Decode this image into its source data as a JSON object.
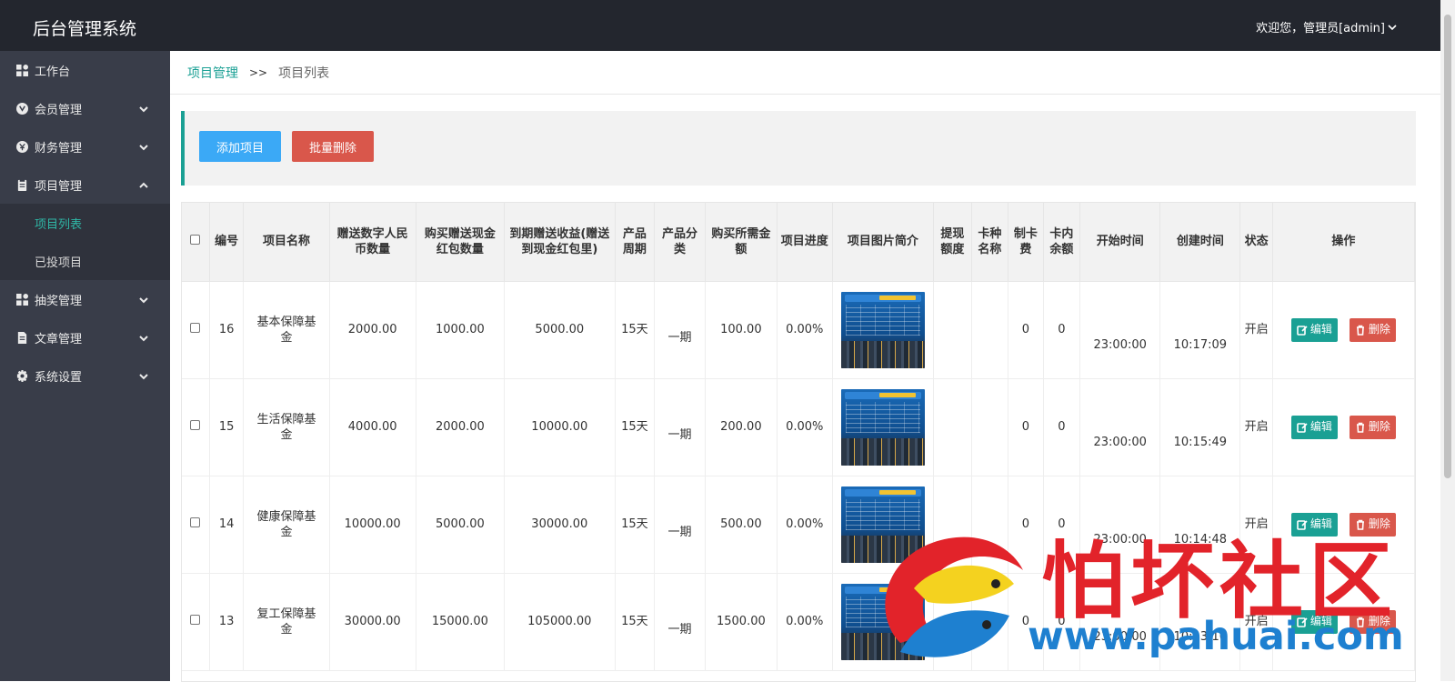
{
  "app": {
    "title": "后台管理系统",
    "welcome": "欢迎您，管理员[admin]"
  },
  "sidebar": {
    "items": [
      {
        "label": "工作台",
        "icon": "dashboard-icon"
      },
      {
        "label": "会员管理",
        "icon": "member-icon"
      },
      {
        "label": "财务管理",
        "icon": "finance-icon"
      },
      {
        "label": "项目管理",
        "icon": "project-icon"
      },
      {
        "label": "抽奖管理",
        "icon": "lottery-icon"
      },
      {
        "label": "文章管理",
        "icon": "article-icon"
      },
      {
        "label": "系统设置",
        "icon": "settings-icon"
      }
    ],
    "project_sub": [
      {
        "label": "项目列表"
      },
      {
        "label": "已投项目"
      }
    ]
  },
  "breadcrumb": {
    "first": "项目管理",
    "separator": ">>",
    "current": "项目列表"
  },
  "toolbar": {
    "add_label": "添加项目",
    "batch_delete_label": "批量删除"
  },
  "table": {
    "headers": {
      "id": "编号",
      "name": "项目名称",
      "digital": "赠送数字人民币数量",
      "cash_red": "购买赠送现金红包数量",
      "maturity": "到期赠送收益(赠送到现金红包里)",
      "cycle": "产品周期",
      "category": "产品分类",
      "amount": "购买所需金额",
      "progress": "项目进度",
      "image": "项目图片简介",
      "withdraw": "提现额度",
      "card_name": "卡种名称",
      "card_fee": "制卡费",
      "card_balance": "卡内余额",
      "start": "开始时间",
      "created": "创建时间",
      "status": "状态",
      "ops": "操作"
    },
    "rows": [
      {
        "id": "16",
        "name": "基本保障基金",
        "digital": "2000.00",
        "cash_red": "1000.00",
        "maturity": "5000.00",
        "cycle": "15天",
        "category": "一期",
        "amount": "100.00",
        "progress": "0.00%",
        "withdraw": "",
        "card_name": "",
        "card_fee": "0",
        "card_balance": "0",
        "start": "23:00:00",
        "created": "10:17:09",
        "status": "开启"
      },
      {
        "id": "15",
        "name": "生活保障基金",
        "digital": "4000.00",
        "cash_red": "2000.00",
        "maturity": "10000.00",
        "cycle": "15天",
        "category": "一期",
        "amount": "200.00",
        "progress": "0.00%",
        "withdraw": "",
        "card_name": "",
        "card_fee": "0",
        "card_balance": "0",
        "start": "23:00:00",
        "created": "10:15:49",
        "status": "开启"
      },
      {
        "id": "14",
        "name": "健康保障基金",
        "digital": "10000.00",
        "cash_red": "5000.00",
        "maturity": "30000.00",
        "cycle": "15天",
        "category": "一期",
        "amount": "500.00",
        "progress": "0.00%",
        "withdraw": "",
        "card_name": "",
        "card_fee": "0",
        "card_balance": "0",
        "start": "23:00:00",
        "created": "10:14:48",
        "status": "开启"
      },
      {
        "id": "13",
        "name": "复工保障基金",
        "digital": "30000.00",
        "cash_red": "15000.00",
        "maturity": "105000.00",
        "cycle": "15天",
        "category": "一期",
        "amount": "1500.00",
        "progress": "0.00%",
        "withdraw": "",
        "card_name": "",
        "card_fee": "0",
        "card_balance": "0",
        "start": "23:00:00",
        "created": "10:13:16",
        "status": "开启"
      }
    ],
    "edit_label": "编辑",
    "delete_label": "删除"
  },
  "watermark": {
    "title": "怕坏社区",
    "url": "www.pahuai.com"
  },
  "colors": {
    "topbar": "#23262e",
    "sidebar": "#393d49",
    "accent": "#1aa094",
    "add": "#3ba9f6",
    "danger": "#d9574b"
  }
}
